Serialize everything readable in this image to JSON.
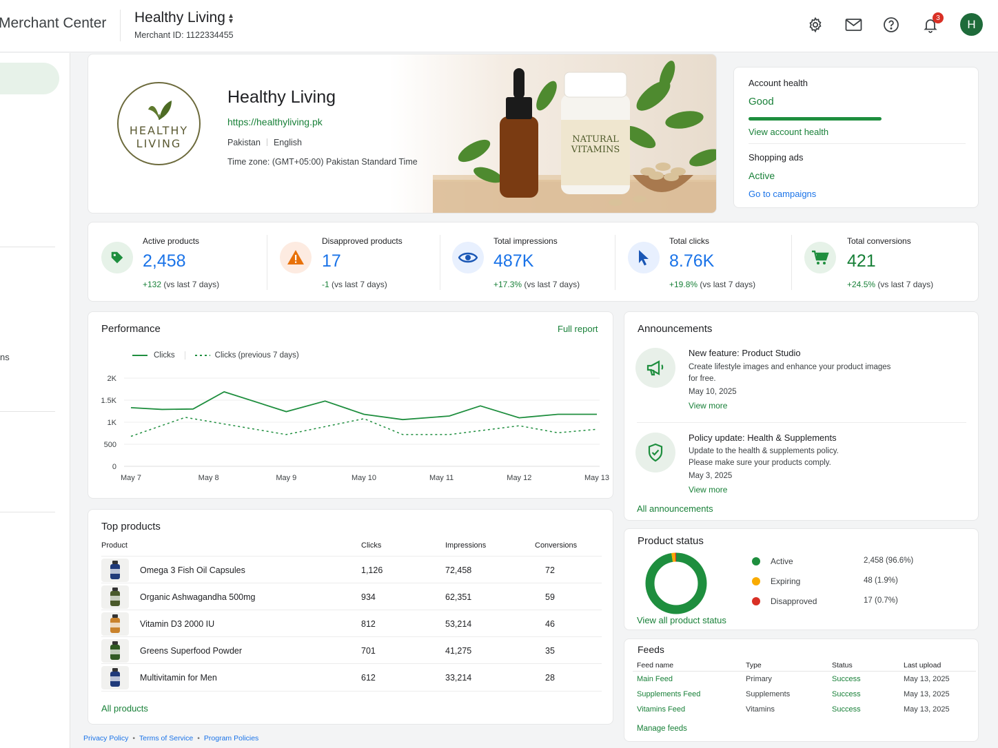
{
  "header": {
    "app_title": "Merchant Center",
    "account_name": "Healthy Living",
    "merchant_id": "Merchant ID: 1122334455",
    "notification_count": "3",
    "avatar_initial": "H"
  },
  "sidebar": {
    "partial_item_label": "ns"
  },
  "profile": {
    "logo_text_line1": "HEALTHY",
    "logo_text_line2": "LIVING",
    "name": "Healthy Living",
    "url": "https://healthyliving.pk",
    "country": "Pakistan",
    "language": "English",
    "timezone": "Time zone: (GMT+05:00) Pakistan Standard Time",
    "image_bottle_label_line1": "NATURAL",
    "image_bottle_label_line2": "VITAMINS"
  },
  "account_health": {
    "label": "Account health",
    "status": "Good",
    "health_level": 1.0,
    "link": "View account health",
    "ads_label": "Shopping ads",
    "ads_status": "Active",
    "ads_link": "Go to campaigns"
  },
  "kpis": [
    {
      "label": "Active products",
      "value": "2,458",
      "delta": "+132",
      "delta_suffix": "(vs last 7 days)",
      "icon": "tag-icon",
      "color": "#1a73e8"
    },
    {
      "label": "Disapproved products",
      "value": "17",
      "delta": "-1",
      "delta_suffix": "(vs last 7 days)",
      "icon": "warning-icon",
      "color": "#1a73e8"
    },
    {
      "label": "Total impressions",
      "value": "487K",
      "delta": "+17.3%",
      "delta_suffix": "(vs last 7 days)",
      "icon": "eye-icon",
      "color": "#1a73e8"
    },
    {
      "label": "Total clicks",
      "value": "8.76K",
      "delta": "+19.8%",
      "delta_suffix": "(vs last 7 days)",
      "icon": "cursor-icon",
      "color": "#1a73e8"
    },
    {
      "label": "Total conversions",
      "value": "421",
      "delta": "+24.5%",
      "delta_suffix": "(vs last 7 days)",
      "icon": "cart-icon",
      "color": "#188038"
    }
  ],
  "performance": {
    "title": "Performance",
    "full_report": "Full report"
  },
  "chart_data": {
    "type": "line",
    "x": [
      "May 7",
      "May 8",
      "May 9",
      "May 10",
      "May 11",
      "May 12",
      "May 13"
    ],
    "series": [
      {
        "name": "Clicks",
        "style": "solid",
        "color": "#1e8e3e",
        "x": [
          0,
          0.4,
          0.8,
          1.2,
          2,
          2.5,
          3,
          3.5,
          4.1,
          4.5,
          5,
          5.5,
          6
        ],
        "values": [
          1330,
          1290,
          1300,
          1690,
          1240,
          1480,
          1180,
          1060,
          1140,
          1370,
          1100,
          1180,
          1180
        ]
      },
      {
        "name": "Clicks (previous 7 days)",
        "style": "dashed",
        "color": "#1e8e3e",
        "x": [
          0,
          0.7,
          2,
          3,
          3.5,
          4.1,
          5,
          5.5,
          6
        ],
        "values": [
          680,
          1110,
          720,
          1080,
          720,
          720,
          920,
          760,
          840
        ]
      }
    ],
    "yticks": [
      "0",
      "500",
      "1K",
      "1.5K",
      "2K"
    ],
    "ylim": [
      0,
      2000
    ],
    "grid": true,
    "legend": "top-left"
  },
  "announcements": {
    "title": "Announcements",
    "items": [
      {
        "title": "New feature: Product Studio",
        "body": "Create lifestyle images and enhance your product images for free.",
        "date": "May 10, 2025",
        "link": "View more",
        "icon": "megaphone-icon"
      },
      {
        "title": "Policy update: Health & Supplements",
        "body": "Update to the health & supplements policy. Please make sure your products comply.",
        "date": "May 3, 2025",
        "link": "View more",
        "icon": "shield-icon"
      }
    ],
    "all_link": "All announcements"
  },
  "top_products": {
    "title": "Top products",
    "columns": [
      "Product",
      "Clicks",
      "Impressions",
      "Conversions"
    ],
    "rows": [
      {
        "name": "Omega 3 Fish Oil Capsules",
        "clicks": "1,126",
        "impressions": "72,458",
        "conversions": "72",
        "thumb_color": "#1f3a7a"
      },
      {
        "name": "Organic Ashwagandha 500mg",
        "clicks": "934",
        "impressions": "62,351",
        "conversions": "59",
        "thumb_color": "#4a5a2a"
      },
      {
        "name": "Vitamin D3 2000 IU",
        "clicks": "812",
        "impressions": "53,214",
        "conversions": "46",
        "thumb_color": "#c9822b"
      },
      {
        "name": "Greens Superfood Powder",
        "clicks": "701",
        "impressions": "41,275",
        "conversions": "35",
        "thumb_color": "#2f5a23"
      },
      {
        "name": "Multivitamin for Men",
        "clicks": "612",
        "impressions": "33,214",
        "conversions": "28",
        "thumb_color": "#1f3a7a"
      }
    ],
    "all_link": "All products"
  },
  "product_status": {
    "title": "Product status",
    "items": [
      {
        "label": "Active",
        "value": "2,458 (96.6%)",
        "color": "#1e8e3e",
        "share": 96.6
      },
      {
        "label": "Expiring",
        "value": "48 (1.9%)",
        "color": "#f9ab00",
        "share": 1.9
      },
      {
        "label": "Disapproved",
        "value": "17 (0.7%)",
        "color": "#d93025",
        "share": 0.7
      }
    ],
    "link": "View all product status"
  },
  "feeds": {
    "title": "Feeds",
    "columns": [
      "Feed name",
      "Type",
      "Status",
      "Last upload"
    ],
    "rows": [
      {
        "name": "Main Feed",
        "type": "Primary",
        "status": "Success",
        "last_upload": "May 13, 2025"
      },
      {
        "name": "Supplements Feed",
        "type": "Supplements",
        "status": "Success",
        "last_upload": "May 13, 2025"
      },
      {
        "name": "Vitamins Feed",
        "type": "Vitamins",
        "status": "Success",
        "last_upload": "May 13, 2025"
      }
    ],
    "manage_link": "Manage feeds"
  },
  "footer": {
    "links": [
      "Privacy Policy",
      "Terms of Service",
      "Program Policies"
    ]
  }
}
